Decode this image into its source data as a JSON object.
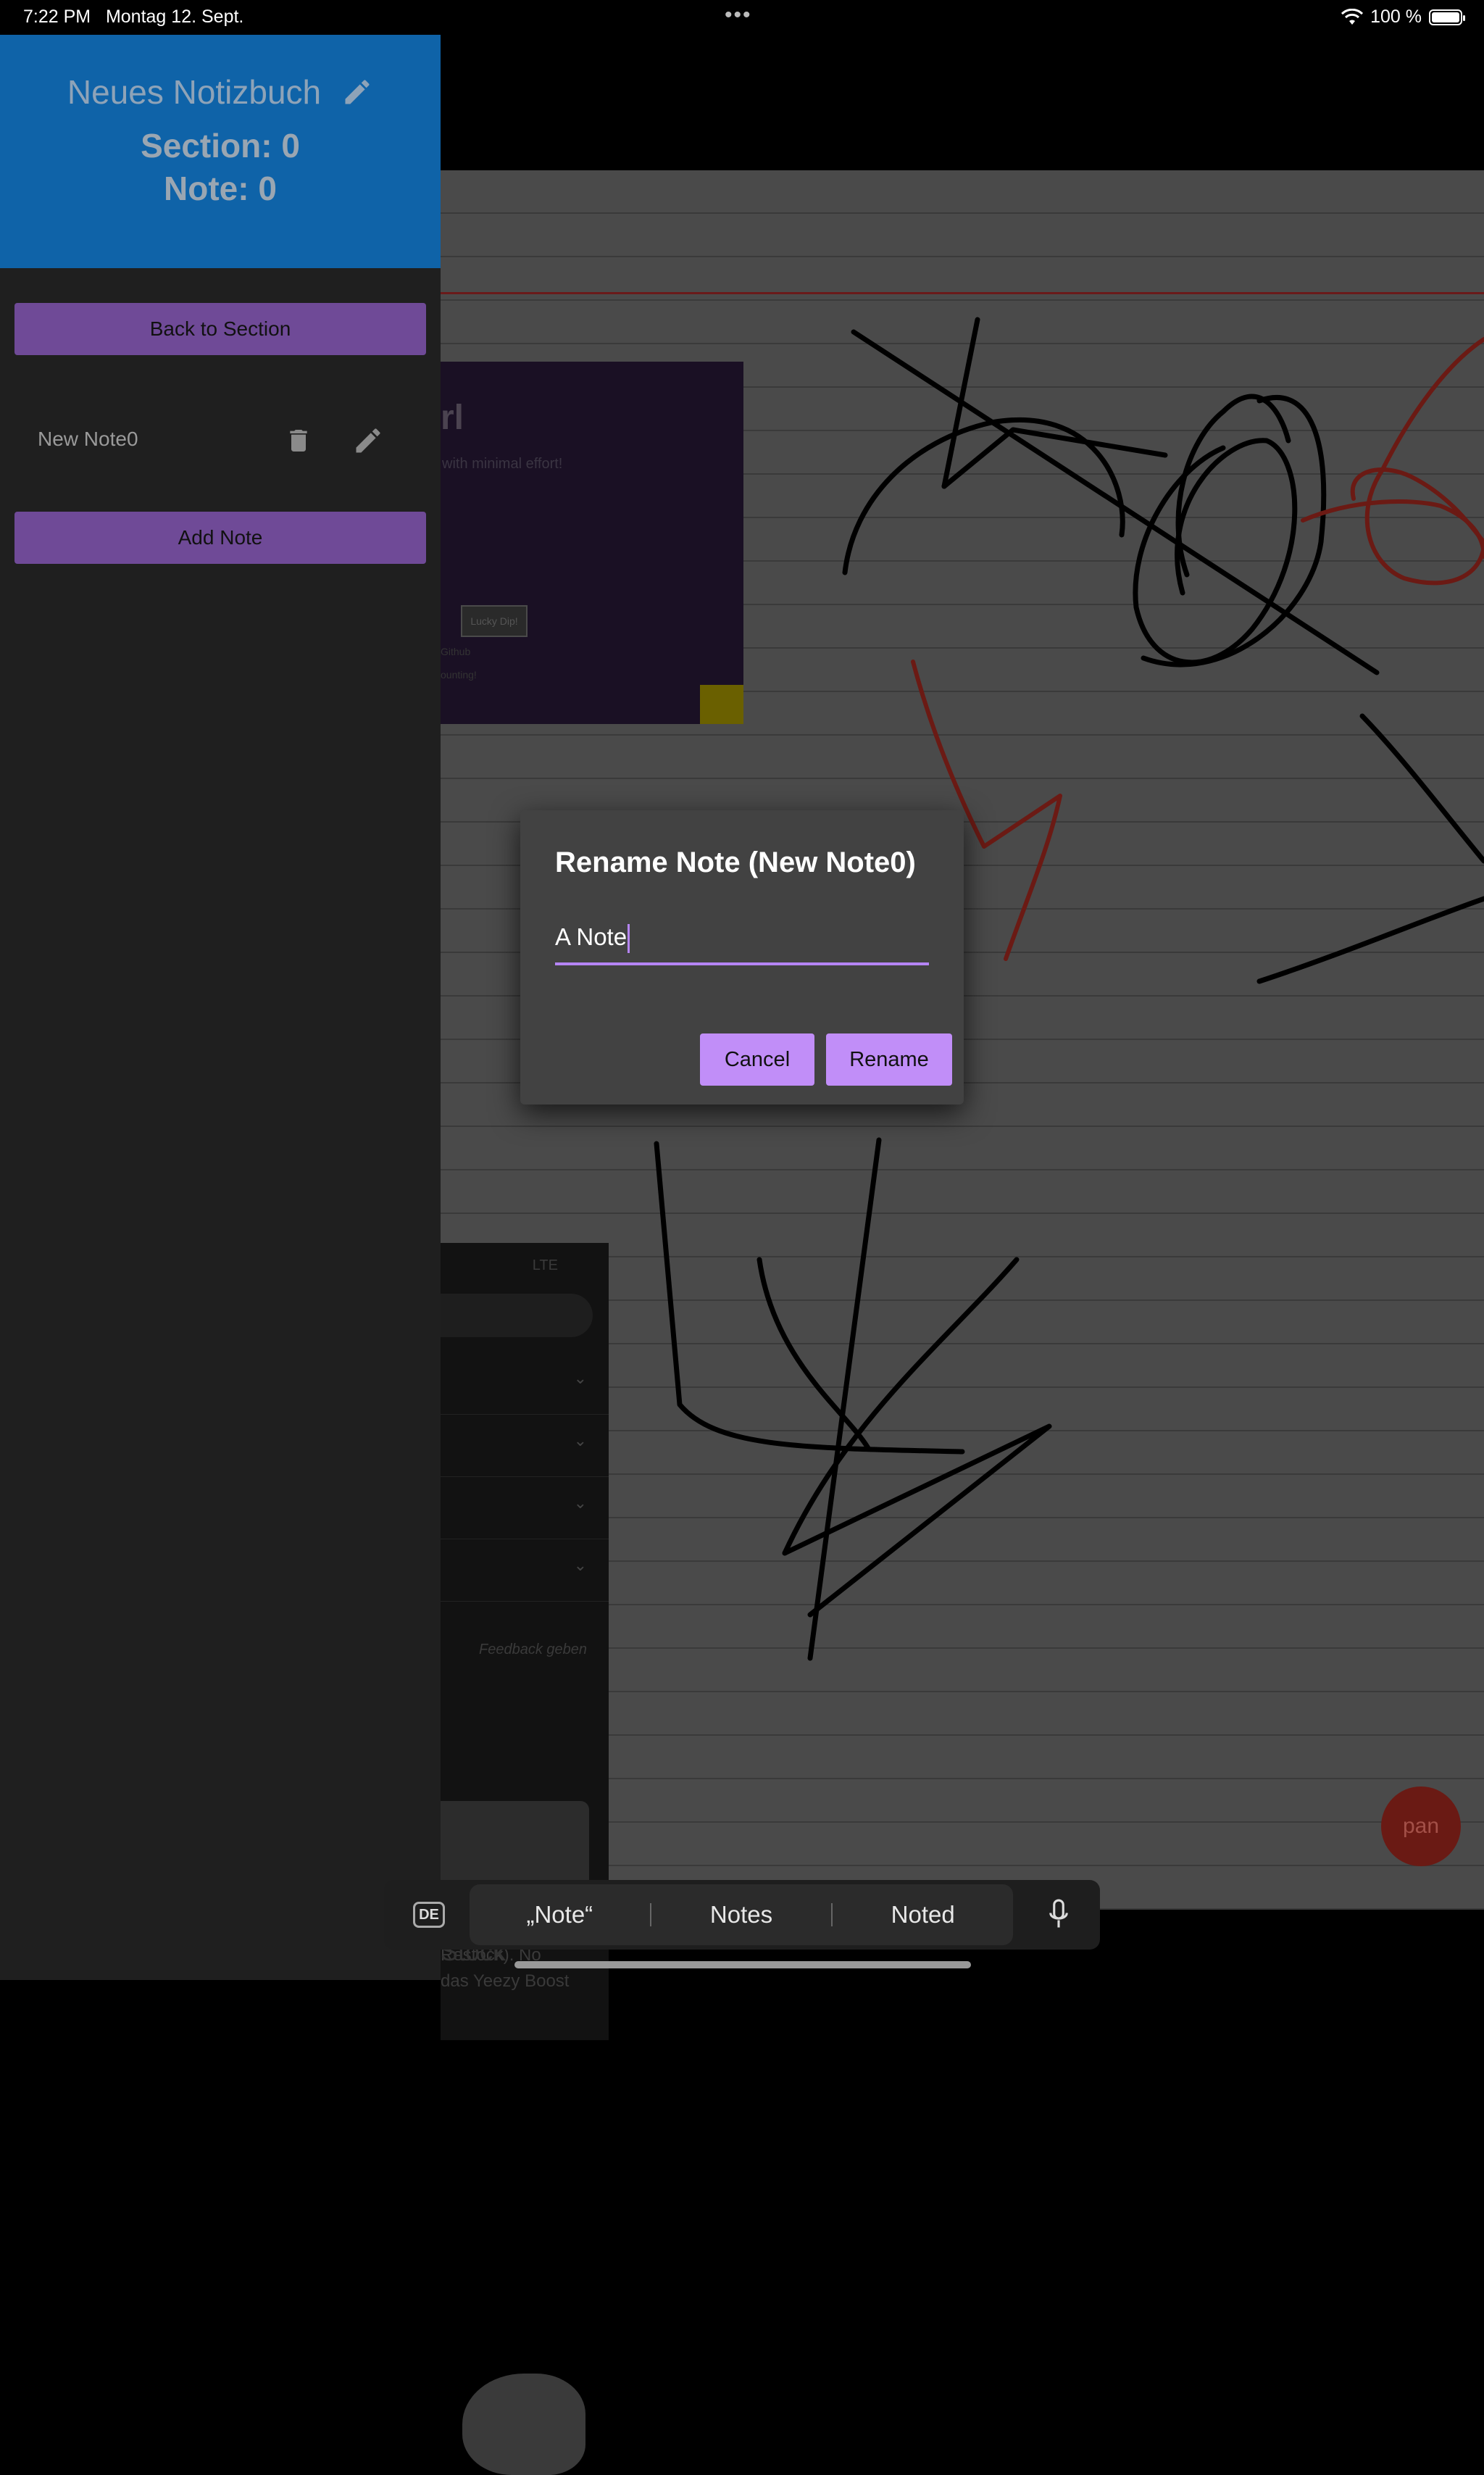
{
  "status_bar": {
    "time": "7:22 PM",
    "date": "Montag 12. Sept.",
    "dots": "•••",
    "battery_text": "100 %",
    "battery_level": 1.0
  },
  "drawer": {
    "notebook_title": "Neues Notizbuch",
    "section_line": "Section: 0",
    "note_line": "Note: 0",
    "back_label": "Back to Section",
    "notes": [
      {
        "label": "New Note0"
      }
    ],
    "add_label": "Add Note"
  },
  "background": {
    "embed_title": "rl",
    "embed_subtitle": "with minimal effort!",
    "embed_button": "Lucky Dip!",
    "embed_link1": "Github",
    "embed_link2": "ounting!",
    "phone_lte": "LTE",
    "phone_feedback": "Feedback geben",
    "phone_caption1": "Restock). No",
    "phone_caption2": "das Yeezy Boost",
    "phone_footer": "Stock",
    "fab_label": "pan"
  },
  "dialog": {
    "title": "Rename Note (New Note0)",
    "input_value": "A Note",
    "cancel_label": "Cancel",
    "rename_label": "Rename"
  },
  "keyboard": {
    "lang": "DE",
    "suggestions": [
      "„Note“",
      "Notes",
      "Noted"
    ]
  },
  "colors": {
    "drawer_header": "#0f63a8",
    "accent_purple": "#c18ef8",
    "drawer_button": "#6f4a97"
  }
}
